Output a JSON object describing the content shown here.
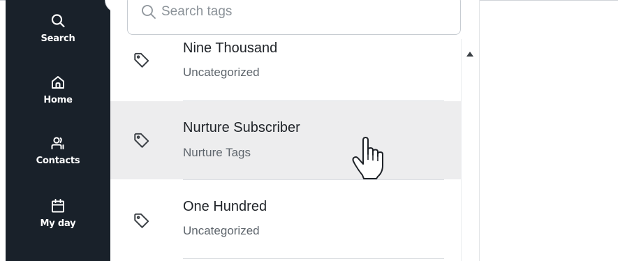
{
  "sidebar": {
    "items": [
      {
        "label": "Search",
        "icon": "search-icon"
      },
      {
        "label": "Home",
        "icon": "home-icon"
      },
      {
        "label": "Contacts",
        "icon": "contacts-icon"
      },
      {
        "label": "My day",
        "icon": "calendar-icon"
      }
    ]
  },
  "search": {
    "placeholder": "Search tags",
    "value": ""
  },
  "tags": [
    {
      "name": "Nine Thousand",
      "category": "Uncategorized",
      "hovered": false
    },
    {
      "name": "Nurture Subscriber",
      "category": "Nurture Tags",
      "hovered": true
    },
    {
      "name": "One Hundred",
      "category": "Uncategorized",
      "hovered": false
    }
  ],
  "colors": {
    "sidebar_bg": "#19212a",
    "hover_row_bg": "#ededee",
    "text_primary": "#1f2328",
    "text_secondary": "#5e656c"
  }
}
